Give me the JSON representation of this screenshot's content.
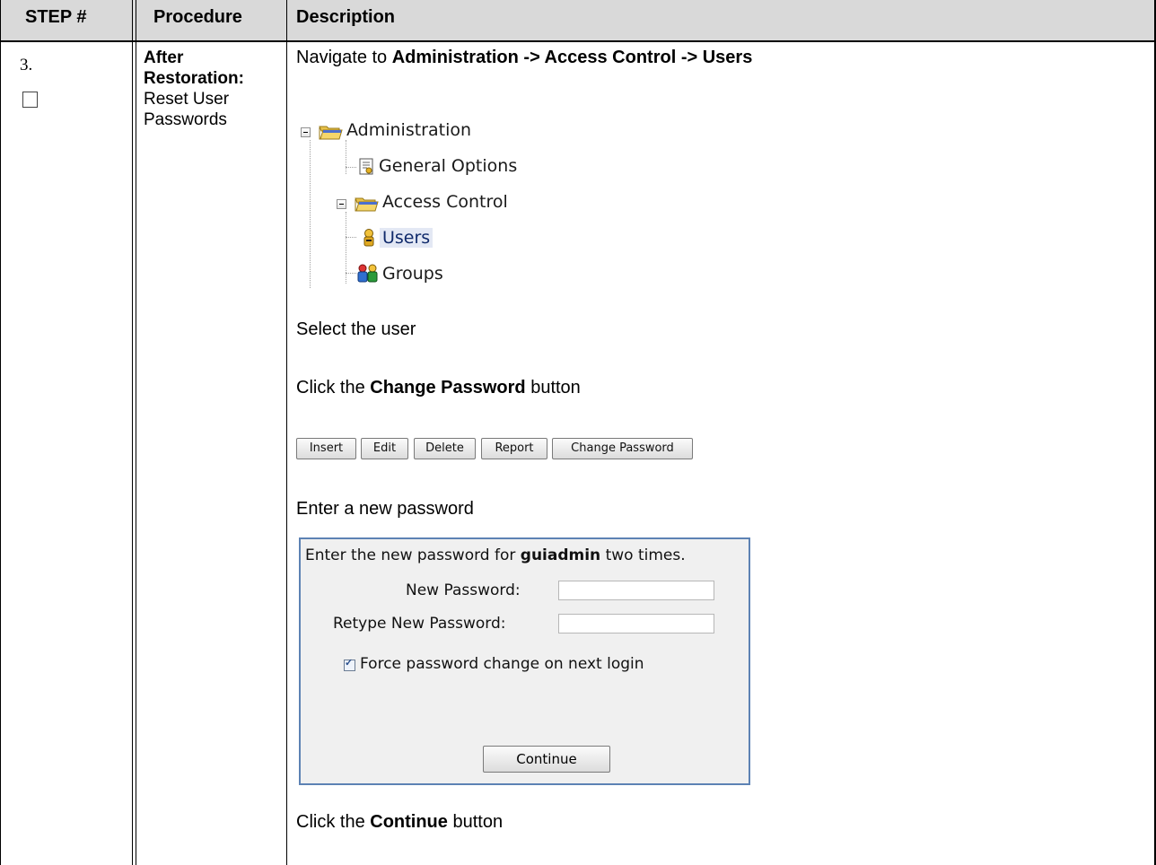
{
  "table": {
    "headers": {
      "step": "STEP #",
      "procedure": "Procedure",
      "description": "Description"
    }
  },
  "step": {
    "number": "3.",
    "procedure_bold": "After Restoration:",
    "procedure_text": "Reset User Passwords"
  },
  "description": {
    "nav_prefix": "Navigate to ",
    "nav_path": "Administration -> Access Control -> Users",
    "select_user": "Select the user",
    "click_prefix": "Click the ",
    "change_password_bold": "Change Password",
    "button_suffix": " button",
    "enter_password": "Enter a new password",
    "click_continue_prefix": "Click the ",
    "continue_bold": "Continue",
    "continue_suffix": " button"
  },
  "tree": {
    "administration": "Administration",
    "general_options": "General Options",
    "access_control": "Access Control",
    "users": "Users",
    "groups": "Groups"
  },
  "toolbar": {
    "insert": "Insert",
    "edit": "Edit",
    "delete": "Delete",
    "report": "Report",
    "change_password": "Change Password"
  },
  "dialog": {
    "intro_prefix": "Enter the new password for ",
    "intro_user": "guiadmin",
    "intro_suffix": " two times.",
    "new_password_label": "New Password:",
    "retype_label": "Retype New Password:",
    "new_password_value": "",
    "retype_value": "",
    "force_change_label": "Force password change on next login",
    "force_change_checked": true,
    "continue_label": "Continue"
  }
}
